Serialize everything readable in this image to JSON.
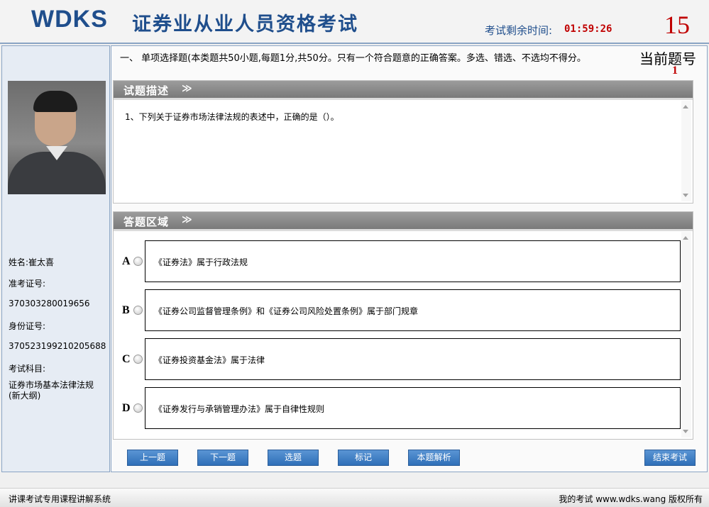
{
  "header": {
    "logo": "WDKS",
    "title": "证券业从业人员资格考试",
    "timer_label": "考试剩余时间:",
    "timer_value": "01:59:26",
    "big_number": "15"
  },
  "candidate": {
    "name_label": "姓名:",
    "name": "崔太喜",
    "exam_id_label": "准考证号:",
    "exam_id": "370303280019656",
    "id_card_label": "身份证号:",
    "id_card": "370523199210205688",
    "subject_label": "考试科目:",
    "subject_line1": "证券市场基本法律法规",
    "subject_line2": "(新大纲)"
  },
  "section": {
    "header": "一、   单项选择题(本类题共50小题,每题1分,共50分。只有一个符合题意的正确答案。多选、错选、不选均不得分。",
    "current_label": "当前题号",
    "current_number": "1"
  },
  "question_pane": {
    "title": "试题描述",
    "arrow": "≫",
    "text": "1、下列关于证券市场法律法规的表述中，正确的是（）。"
  },
  "answer_pane": {
    "title": "答题区域",
    "arrow": "≫",
    "options": [
      {
        "letter": "A",
        "text": "《证券法》属于行政法规"
      },
      {
        "letter": "B",
        "text": "《证券公司监督管理条例》和《证券公司风险处置条例》属于部门规章"
      },
      {
        "letter": "C",
        "text": "《证券投资基金法》属于法律"
      },
      {
        "letter": "D",
        "text": "《证券发行与承销管理办法》属于自律性规则"
      }
    ]
  },
  "buttons": {
    "prev": "上一题",
    "next": "下一题",
    "select": "选题",
    "mark": "标记",
    "analysis": "本题解析",
    "finish": "结束考试"
  },
  "footer": {
    "left": "讲课考试专用课程讲解系统",
    "right": "我的考试 www.wdks.wang 版权所有"
  },
  "colors": {
    "brand_blue": "#1f4e8c",
    "timer_red": "#c00000",
    "button_blue": "#2f6fb8"
  }
}
